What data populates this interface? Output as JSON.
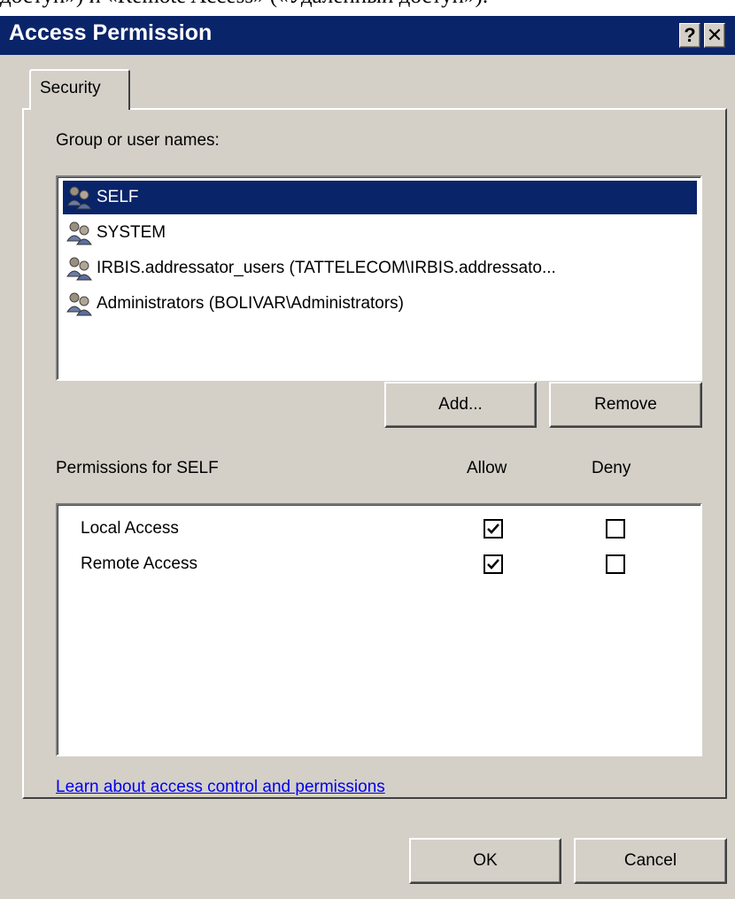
{
  "doc_text": "доступ») и «Remote Access» («Удаленный доступ»).",
  "titlebar": {
    "title": "Access Permission",
    "help_button": "?",
    "close_button": "✕"
  },
  "tabs": [
    {
      "label": "Security"
    }
  ],
  "groups": {
    "label": "Group or user names:",
    "items": [
      {
        "name": "SELF",
        "selected": true
      },
      {
        "name": "SYSTEM",
        "selected": false
      },
      {
        "name": "IRBIS.addressator_users (TATTELECOM\\IRBIS.addressato...",
        "selected": false
      },
      {
        "name": "Administrators (BOLIVAR\\Administrators)",
        "selected": false
      }
    ],
    "add_button": "Add...",
    "remove_button": "Remove"
  },
  "permissions": {
    "label": "Permissions for SELF",
    "allow_header": "Allow",
    "deny_header": "Deny",
    "items": [
      {
        "name": "Local Access",
        "allow": true,
        "deny": false
      },
      {
        "name": "Remote Access",
        "allow": true,
        "deny": false
      }
    ]
  },
  "link_text": "Learn about access control and permissions",
  "footer": {
    "ok_button": "OK",
    "cancel_button": "Cancel"
  },
  "icons": {
    "group_icon": "users-group-icon"
  },
  "colors": {
    "titlebar": "#0a246a",
    "dialog_bg": "#d4d0c8",
    "selection": "#0a246a",
    "link": "#0000ee"
  }
}
